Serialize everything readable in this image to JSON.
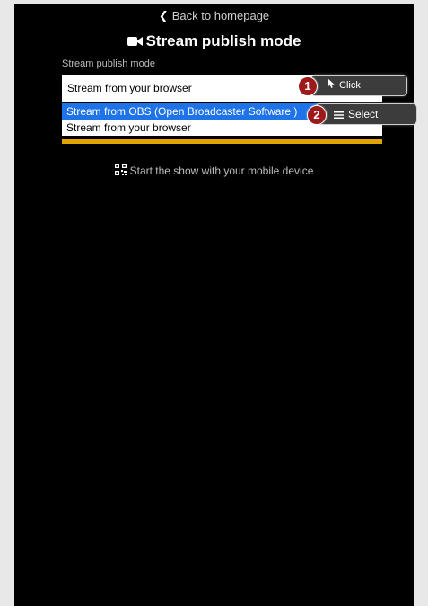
{
  "header": {
    "back_label": "Back to homepage",
    "title": "Stream publish mode"
  },
  "form": {
    "field_label": "Stream publish mode",
    "selected_value": "Stream from your browser",
    "options": [
      "Stream from OBS (Open Broadcaster Software )",
      "Stream from your browser"
    ]
  },
  "annotations": {
    "step1": {
      "number": "1",
      "action": "Click",
      "icon": "cursor-icon"
    },
    "step2": {
      "number": "2",
      "action": "Select",
      "icon": "menu-lines-icon"
    }
  },
  "mobile": {
    "label": "Start the show with your mobile device",
    "icon": "qr-code-icon"
  },
  "colors": {
    "background": "#000000",
    "highlight": "#1e73e8",
    "accent_bar": "#e0a400",
    "badge": "#9e1a1a"
  }
}
